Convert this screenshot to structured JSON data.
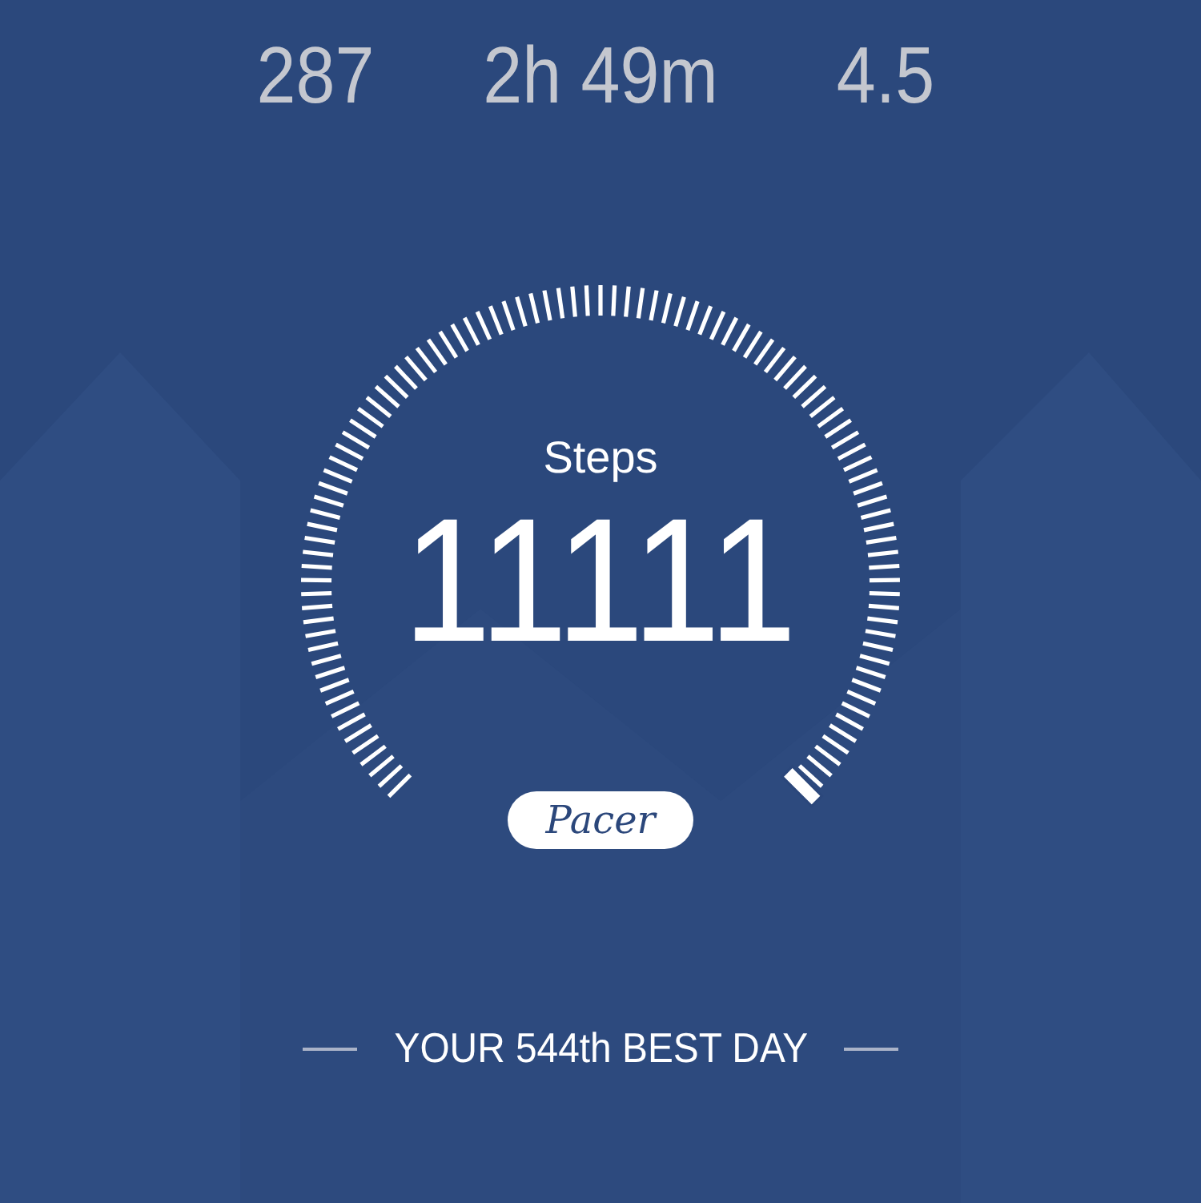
{
  "stats": [
    {
      "value": "287"
    },
    {
      "value": "2h 49m"
    },
    {
      "value": "4.5"
    }
  ],
  "gauge": {
    "label": "Steps",
    "value": "11111"
  },
  "logo": {
    "text": "Pacer"
  },
  "footer": {
    "text": "YOUR 544th BEST DAY"
  }
}
